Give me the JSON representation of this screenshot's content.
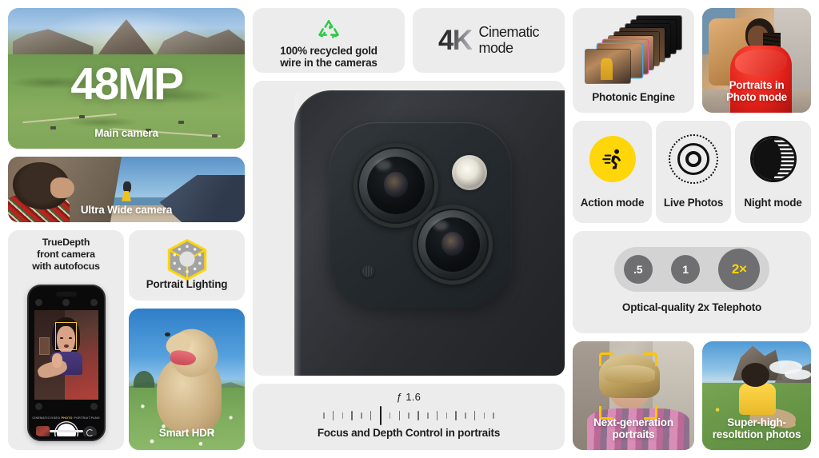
{
  "page": {
    "title": "iPhone camera features grid",
    "background": "#ffffff",
    "card_background": "#ececec",
    "accent_yellow": "#ffd60a",
    "accent_green": "#2ec946",
    "text_color": "#1d1d1f"
  },
  "main_camera": {
    "headline": "48MP",
    "caption": "Main camera",
    "icon": "mountain-landscape-photo"
  },
  "ultra_wide": {
    "caption": "Ultra Wide camera",
    "icon": "beach-people-photo"
  },
  "truedepth": {
    "title_line1": "TrueDepth",
    "title_line2": "front camera",
    "title_line3": "with autofocus",
    "phone": {
      "modes": [
        {
          "label": "CINEMATIC",
          "selected": false
        },
        {
          "label": "VIDEO",
          "selected": false
        },
        {
          "label": "PHOTO",
          "selected": true
        },
        {
          "label": "PORTRAIT",
          "selected": false
        },
        {
          "label": "PANO",
          "selected": false
        }
      ],
      "shutter_label": "shutter-button",
      "thumbnail_label": "photo-library-thumbnail",
      "flip_label": "flip-camera-button",
      "focus_box_color": "#f5c83c"
    }
  },
  "portrait_lighting": {
    "caption": "Portrait Lighting",
    "icon": "studio-light-cube-icon",
    "cube_outline_color": "#ffd60a",
    "cube_fill_color": "#9e9e9e"
  },
  "smart_hdr": {
    "caption": "Smart HDR",
    "icon": "dog-in-field-photo"
  },
  "recycled_gold": {
    "caption_line1": "100% recycled gold",
    "caption_line2": "wire in the cameras",
    "icon": "recycle-icon",
    "icon_color": "#2ec946"
  },
  "cinematic": {
    "resolution": "4K",
    "label_line1": "Cinematic",
    "label_line2": "mode"
  },
  "camera_module": {
    "icon": "iphone-rear-camera-module",
    "parts": [
      "main-lens",
      "ultra-wide-lens",
      "true-tone-flash",
      "microphone"
    ]
  },
  "focus_depth": {
    "aperture": "ƒ 1.6",
    "caption": "Focus and Depth Control in portraits",
    "tick_count": 20,
    "selected_tick_index": 6
  },
  "photonic_engine": {
    "caption": "Photonic Engine",
    "icon": "stacked-photo-frames"
  },
  "portraits_photo_mode": {
    "caption_line1": "Portraits in",
    "caption_line2": "Photo mode",
    "icon": "woman-red-dress-photo"
  },
  "modes": [
    {
      "name": "action",
      "label": "Action mode",
      "icon": "running-person-icon",
      "icon_bg": "#ffd60a"
    },
    {
      "name": "live",
      "label": "Live Photos",
      "icon": "live-photos-icon",
      "icon_bg": "#ececec"
    },
    {
      "name": "night",
      "label": "Night mode",
      "icon": "night-mode-moon-icon",
      "icon_bg": "#ececec"
    }
  ],
  "telephoto": {
    "caption": "Optical-quality 2x Telephoto",
    "zoom_options": [
      {
        "label": ".5",
        "selected": false
      },
      {
        "label": "1",
        "selected": false
      },
      {
        "label": "2×",
        "selected": true
      }
    ],
    "selected_color": "#ffd60a"
  },
  "next_generation": {
    "caption_line1": "Next-generation",
    "caption_line2": "portraits",
    "icon": "blond-person-portrait-photo",
    "bracket_color": "#ffc400"
  },
  "super_high_res": {
    "caption_line1": "Super-high-",
    "caption_line2": "resolution photos",
    "icon": "person-in-alpine-meadow-photo"
  }
}
